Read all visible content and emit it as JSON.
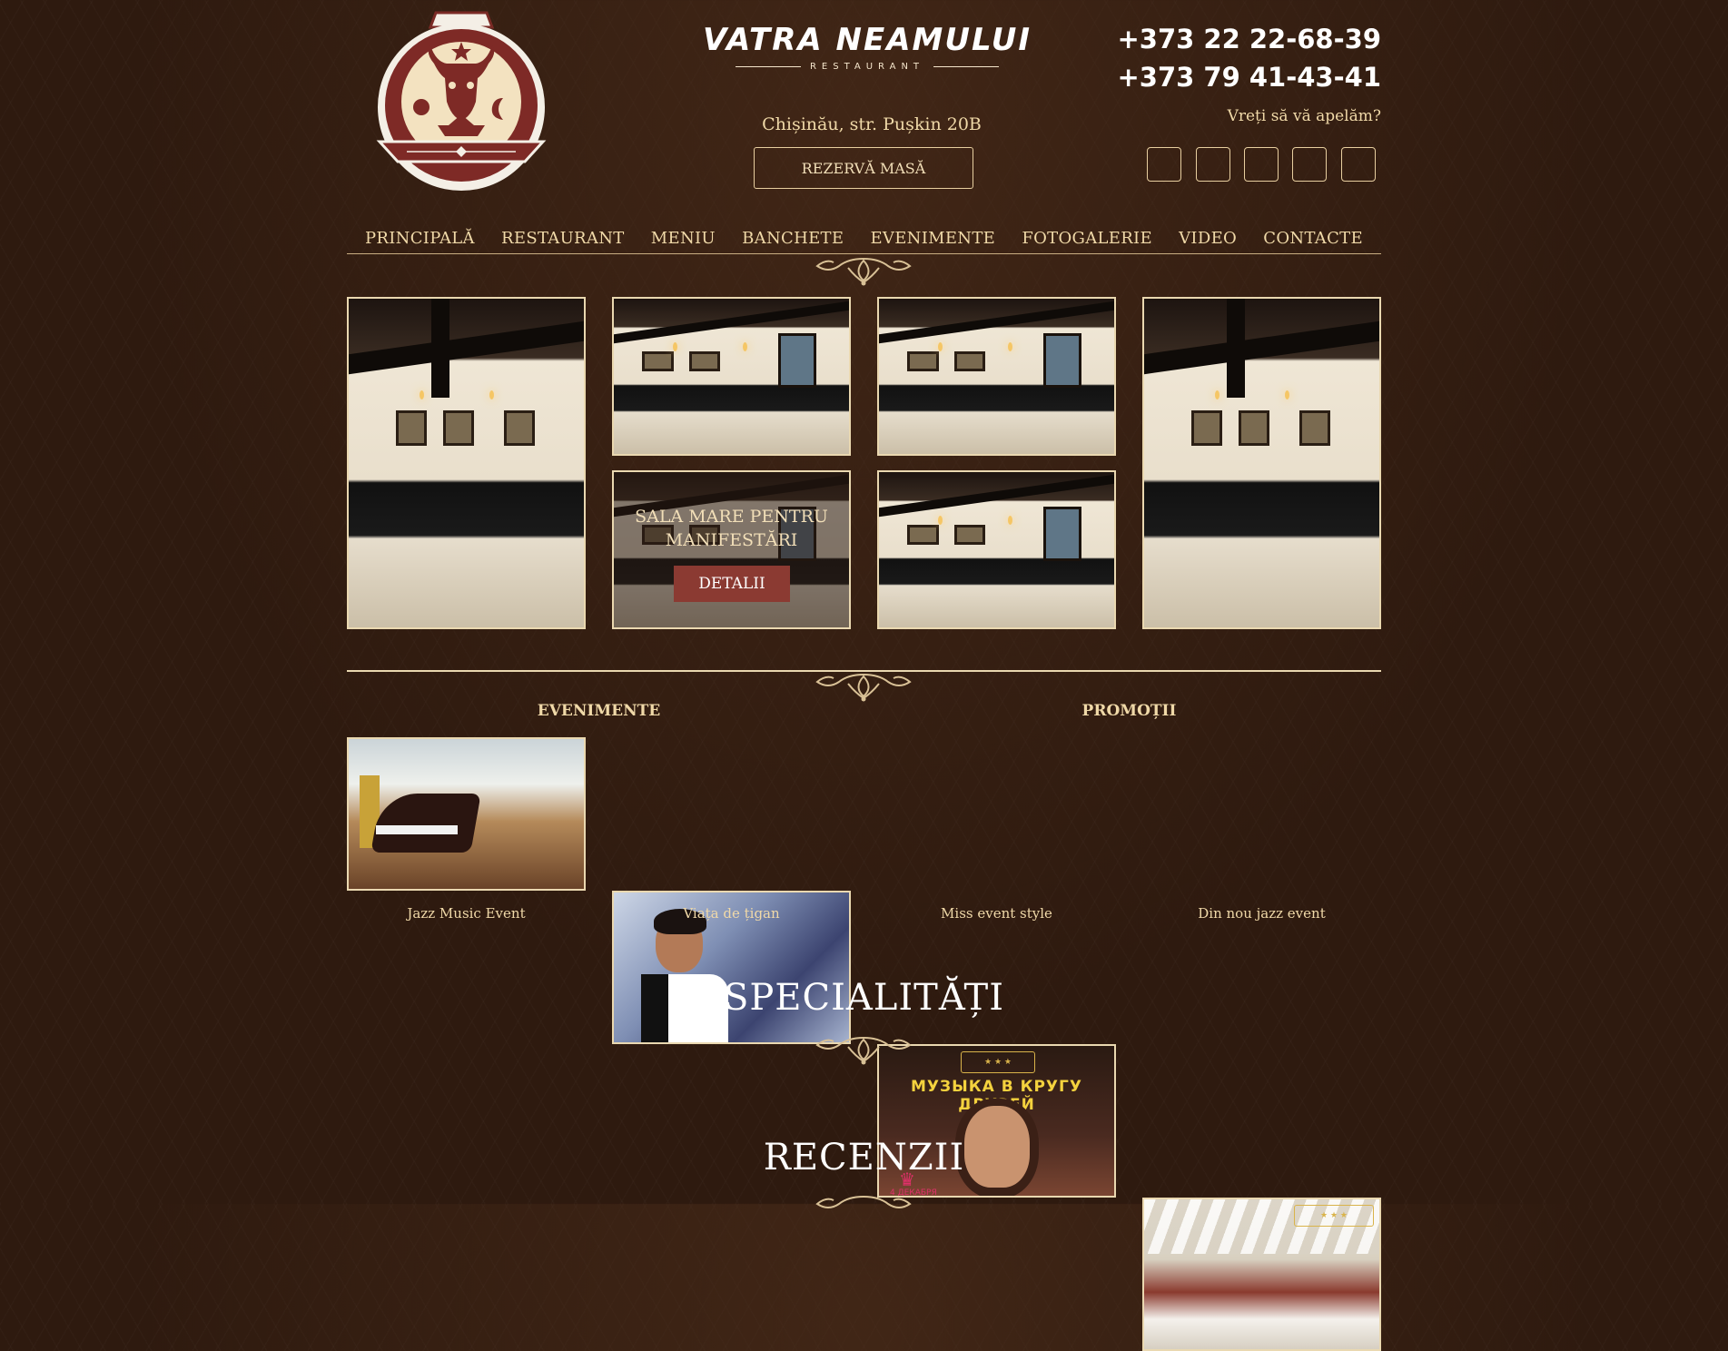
{
  "header": {
    "brand_title": "VATRA NEAMULUI",
    "brand_subtitle": "RESTAURANT",
    "address": "Chișinău, str. Pușkin 20B",
    "reserve_label": "REZERVĂ MASĂ",
    "phone1": "+373 22 22-68-39",
    "phone2": "+373 79 41-43-41",
    "callback_label": "Vreți să vă apelăm?",
    "social_icons": [
      "social-icon-1",
      "social-icon-2",
      "social-icon-3",
      "social-icon-4",
      "social-icon-5"
    ]
  },
  "nav": {
    "items": [
      {
        "label": "PRINCIPALĂ"
      },
      {
        "label": "RESTAURANT"
      },
      {
        "label": "MENIU"
      },
      {
        "label": "BANCHETE"
      },
      {
        "label": "EVENIMENTE"
      },
      {
        "label": "FOTOGALERIE"
      },
      {
        "label": "VIDEO"
      },
      {
        "label": "CONTACTE"
      }
    ]
  },
  "gallery": {
    "overlay_title": "SALA MARE PENTRU MANIFESTĂRI",
    "overlay_button": "DETALII"
  },
  "events": {
    "events_heading": "EVENIMENTE",
    "promo_heading": "PROMOȚII",
    "items": [
      {
        "caption": "Jazz Music Event"
      },
      {
        "caption": "Viața de țigan"
      },
      {
        "caption": "Miss event style",
        "banner_text": "МУЗЫКА В КРУГУ ДРУЗЕЙ",
        "date_text": "4 ДЕКАБРЯ"
      },
      {
        "caption": "Din nou jazz event"
      }
    ]
  },
  "sections": {
    "specialitati": "SPECIALITĂȚI",
    "recenzii": "RECENZII"
  },
  "colors": {
    "background": "#2e1a0f",
    "accent_red": "#8b3a32",
    "cream": "#f0d9a8",
    "border": "#ead8b0"
  }
}
